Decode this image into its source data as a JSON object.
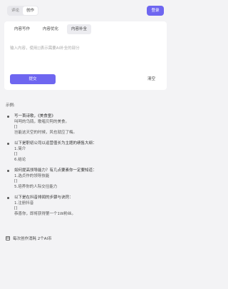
{
  "header": {
    "segments": [
      "评论",
      "创作"
    ],
    "active_segment": 1,
    "login_label": "登录"
  },
  "editor": {
    "tabs": [
      "内容写作",
      "内容优化",
      "内容补全"
    ],
    "active_tab": 2,
    "placeholder": "输入内容，使用[]表示需要AI补全的部分",
    "submit_label": "提交",
    "clear_label": "清空"
  },
  "examples": {
    "title": "示例:",
    "items": [
      {
        "line1": "写一首诗歌，《美食童》",
        "lines": [
          "叫呵的乌鸫，歌唱贝阿的美食。",
          "[]",
          "岂能这天空的时候，风也就应了梅。"
        ]
      },
      {
        "line1": "以下是职初公司以运营值长为主题的绩售大纲：",
        "lines": [
          "1.简介",
          "[]",
          "6.结论"
        ]
      },
      {
        "line1": "如何提高领导能力？有几点要素你一定要知道：",
        "lines": [
          "1.选贞作的领导技能",
          "[]",
          "5.培养你的人际交往能力"
        ]
      },
      {
        "line1": "以下是在抖音排闻的步骤与诀窍：",
        "lines": [
          "1.注册抖音",
          "[]",
          "恭喜你，即将获得第一个1W粉丝。"
        ]
      }
    ]
  },
  "footer": {
    "text": "每次创作消耗 2个AI币"
  },
  "colors": {
    "accent": "#6e66f0",
    "background": "#f3f3f5",
    "card": "#ffffff"
  },
  "icons": {
    "footer": "calendar-icon"
  }
}
